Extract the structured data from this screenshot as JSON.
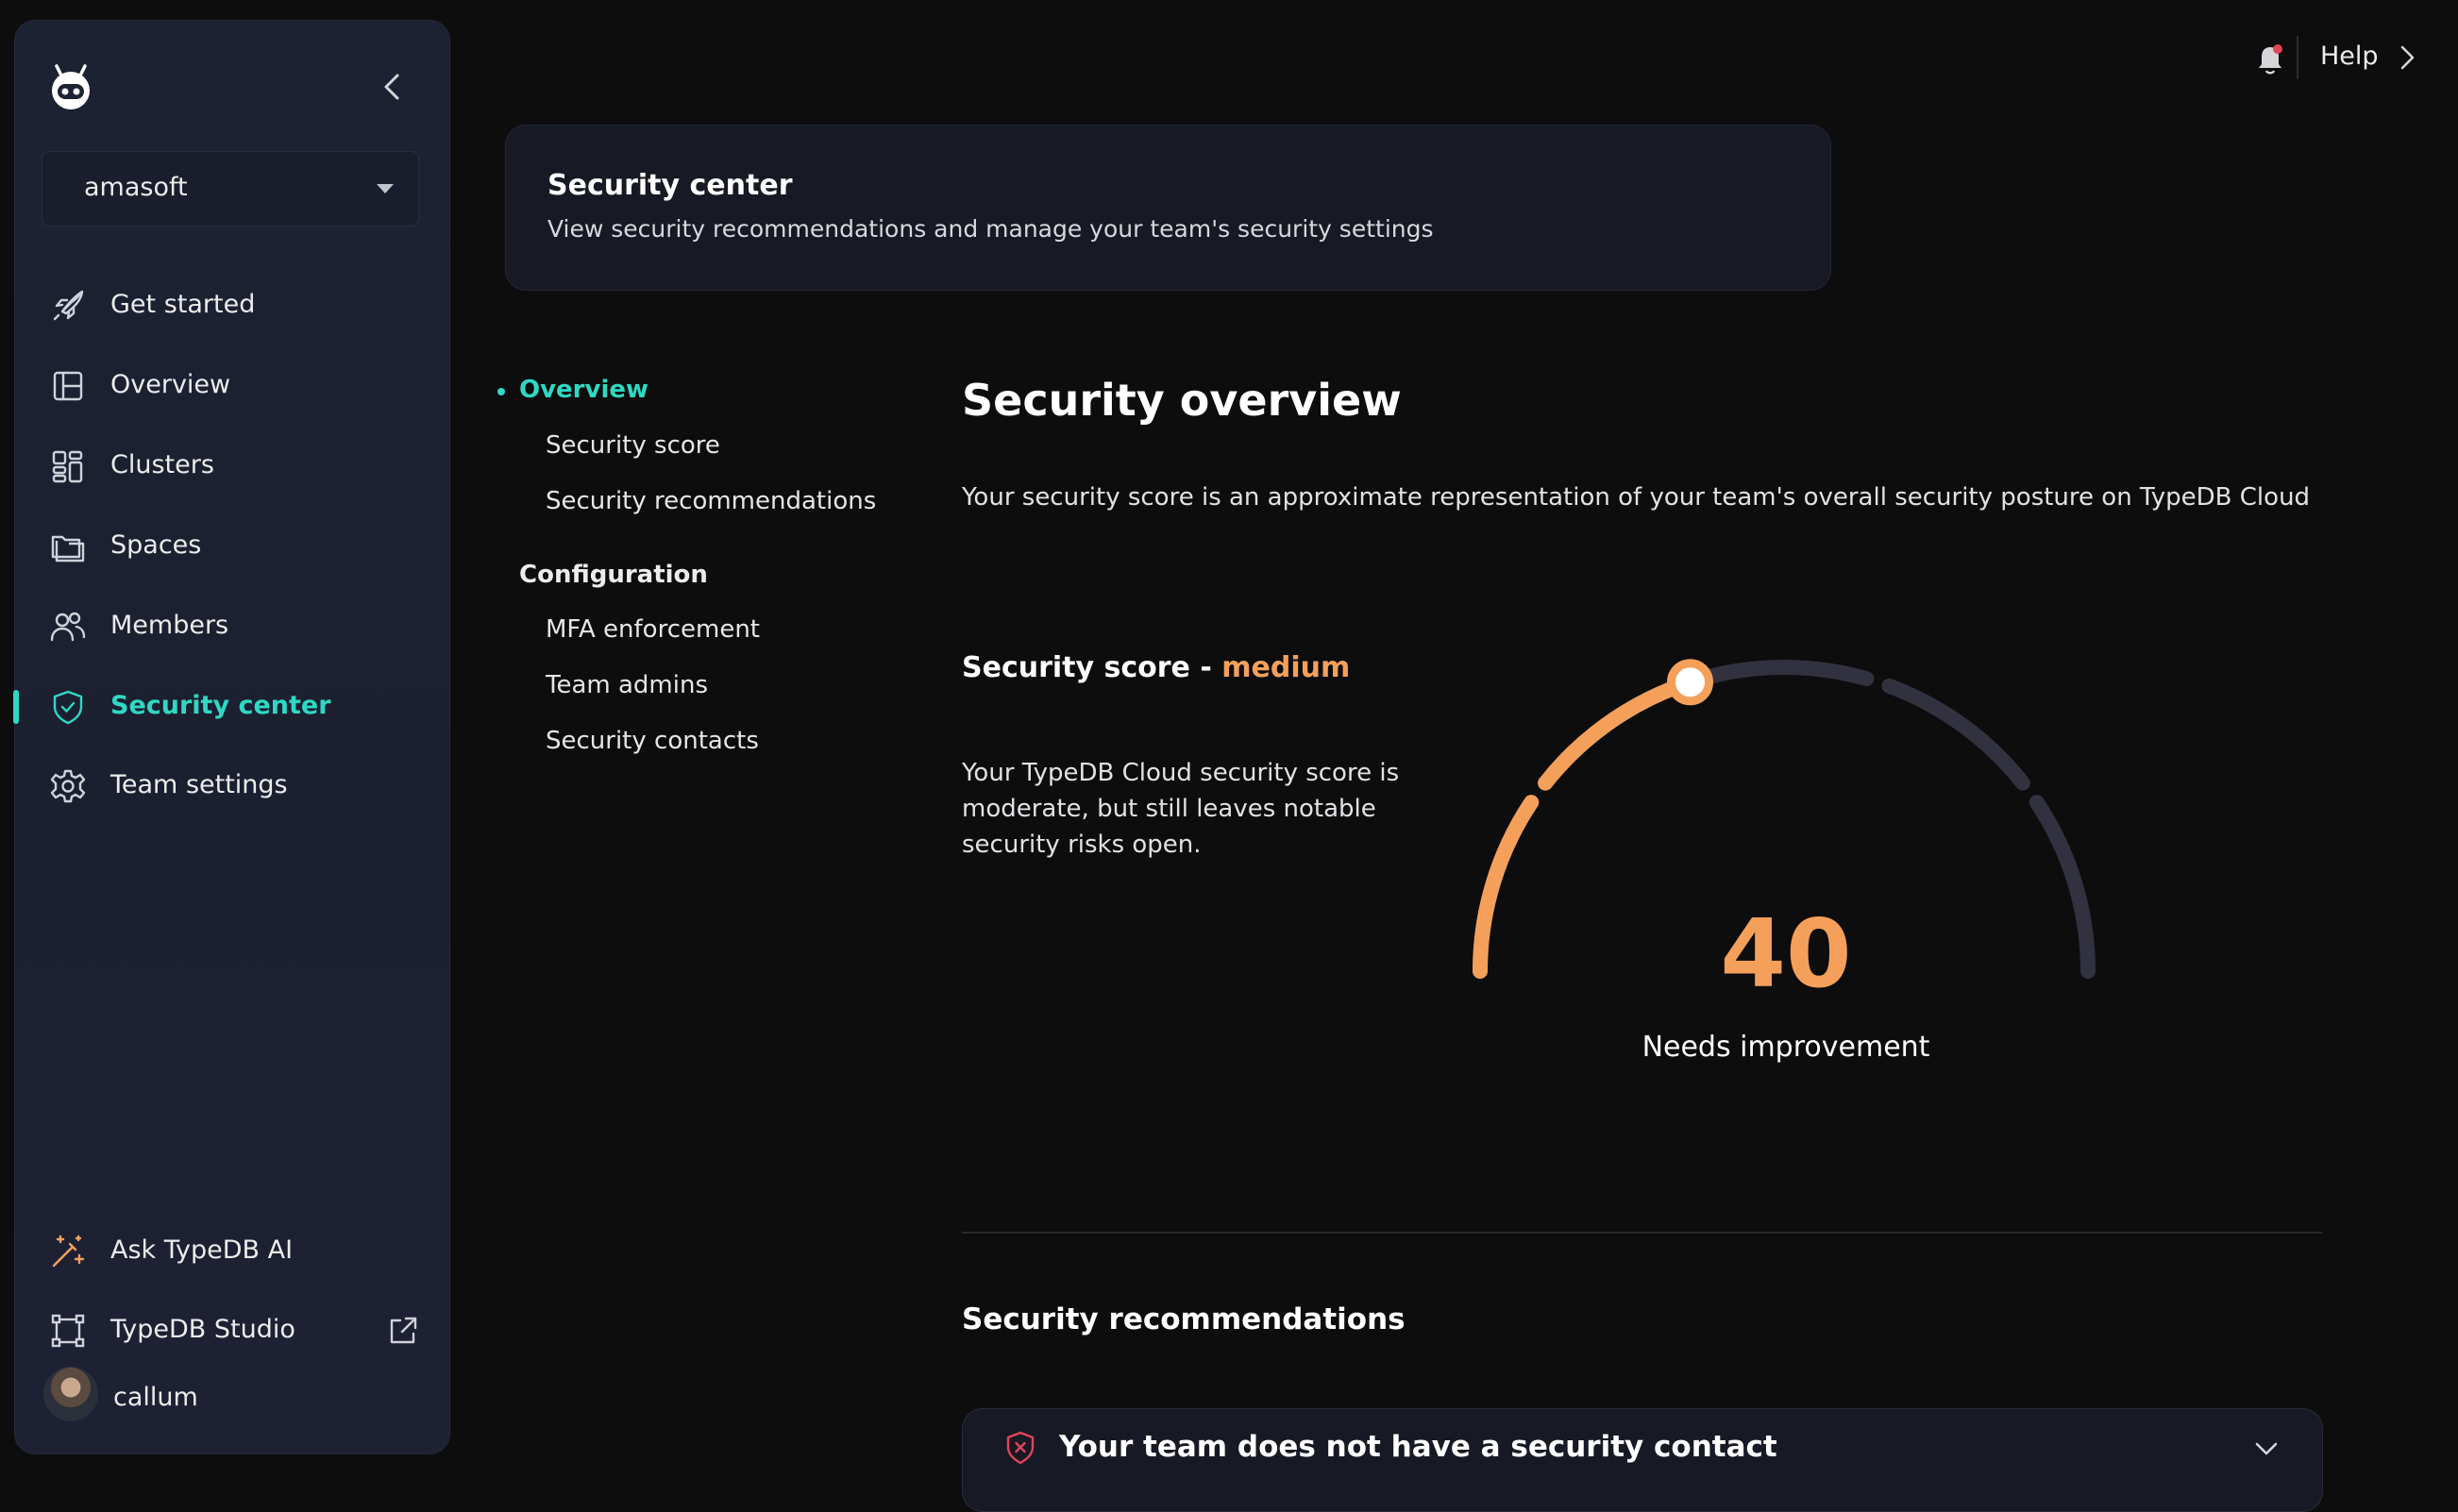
{
  "sidebar": {
    "team": "amasoft",
    "items": [
      {
        "label": "Get started",
        "icon": "rocket-icon"
      },
      {
        "label": "Overview",
        "icon": "layout-icon"
      },
      {
        "label": "Clusters",
        "icon": "clusters-icon"
      },
      {
        "label": "Spaces",
        "icon": "folder-icon"
      },
      {
        "label": "Members",
        "icon": "users-icon"
      },
      {
        "label": "Security center",
        "icon": "shield-check-icon",
        "active": true
      },
      {
        "label": "Team settings",
        "icon": "gear-icon"
      }
    ],
    "bottom": [
      {
        "label": "Ask TypeDB AI",
        "icon": "magic-wand-icon"
      },
      {
        "label": "TypeDB Studio",
        "icon": "studio-icon",
        "external": true
      }
    ],
    "user": "callum"
  },
  "topbar": {
    "help": "Help"
  },
  "header": {
    "title": "Security center",
    "subtitle": "View security recommendations and manage your team's security settings"
  },
  "toc": {
    "overview": "Overview",
    "score": "Security score",
    "recommendations": "Security recommendations",
    "config_title": "Configuration",
    "mfa": "MFA enforcement",
    "admins": "Team admins",
    "contacts": "Security contacts"
  },
  "main": {
    "title": "Security overview",
    "description": "Your security score is an approximate representation of your team's overall security posture on TypeDB Cloud",
    "score_heading": "Security score - ",
    "score_level": "medium",
    "score_text": "Your TypeDB Cloud security score is moderate, but still leaves notable security risks open.",
    "score_value": "40",
    "score_label": "Needs improvement",
    "score_fraction": 0.4,
    "recommendations_title": "Security recommendations",
    "recommendation": "Your team does not have a security contact"
  },
  "colors": {
    "accent": "#2fd8c4",
    "warning": "#f5a05a",
    "gauge_track": "#31313f",
    "danger": "#e0455a"
  }
}
